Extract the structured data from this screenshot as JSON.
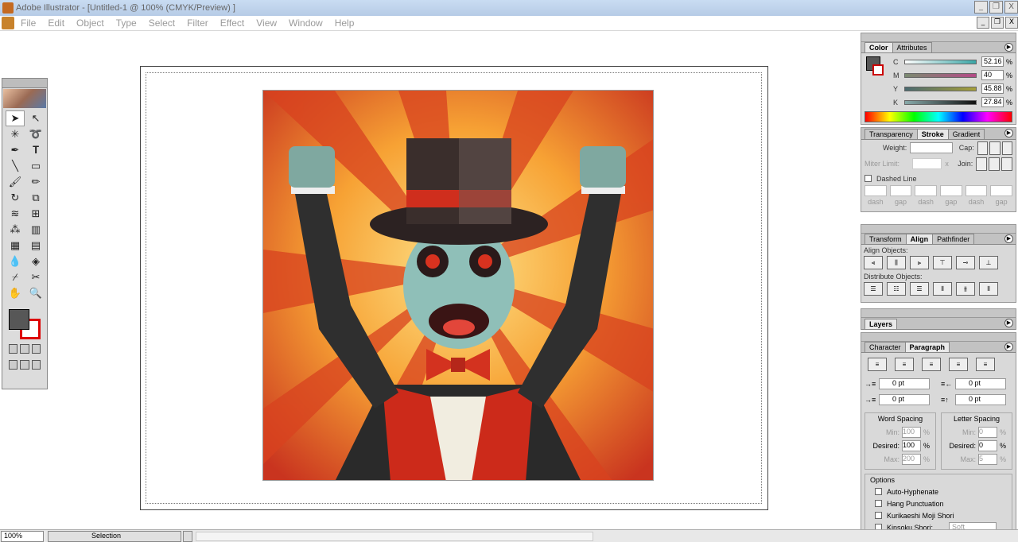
{
  "window": {
    "title": "Adobe Illustrator - [Untitled-1 @ 100% (CMYK/Preview) ]",
    "minimize": "_",
    "restore": "❐",
    "close": "X"
  },
  "menu": [
    "File",
    "Edit",
    "Object",
    "Type",
    "Select",
    "Filter",
    "Effect",
    "View",
    "Window",
    "Help"
  ],
  "color_panel": {
    "tabs": [
      "Color",
      "Attributes"
    ],
    "channels": [
      {
        "label": "C",
        "value": "52.16",
        "unit": "%",
        "color": "#3aa6a6"
      },
      {
        "label": "M",
        "value": "40",
        "unit": "%",
        "color": "#b44a86"
      },
      {
        "label": "Y",
        "value": "45.88",
        "unit": "%",
        "color": "#a7a03a"
      },
      {
        "label": "K",
        "value": "27.84",
        "unit": "%",
        "color": "#222222"
      }
    ]
  },
  "stroke_panel": {
    "tabs": [
      "Transparency",
      "Stroke",
      "Gradient"
    ],
    "weight_label": "Weight:",
    "cap_label": "Cap:",
    "miter_label": "Miter Limit:",
    "miter_unit": "x",
    "join_label": "Join:",
    "dashed_label": "Dashed Line",
    "dash_labels": [
      "dash",
      "gap",
      "dash",
      "gap",
      "dash",
      "gap"
    ]
  },
  "align_panel": {
    "tabs": [
      "Transform",
      "Align",
      "Pathfinder"
    ],
    "align_objects": "Align Objects:",
    "distribute_objects": "Distribute Objects:"
  },
  "layers_panel": {
    "title": "Layers"
  },
  "paragraph_panel": {
    "tabs": [
      "Character",
      "Paragraph"
    ],
    "indent_values": [
      "0 pt",
      "0 pt",
      "0 pt",
      "0 pt"
    ],
    "word_spacing": {
      "title": "Word Spacing",
      "min_label": "Min:",
      "min": "100",
      "desired_label": "Desired:",
      "desired": "100",
      "max_label": "Max:",
      "max": "200",
      "unit": "%"
    },
    "letter_spacing": {
      "title": "Letter Spacing",
      "min_label": "Min:",
      "min": "0",
      "desired_label": "Desired:",
      "desired": "0",
      "max_label": "Max:",
      "max": "5",
      "unit": "%"
    },
    "options_title": "Options",
    "options": [
      "Auto-Hyphenate",
      "Hang Punctuation",
      "Kurikaeshi Moji Shori",
      "Kinsoku Shori:"
    ],
    "kinsoku_value": "Soft"
  },
  "status": {
    "zoom": "100%",
    "mode": "Selection"
  },
  "colors": {
    "fill": "#575757",
    "stroke": "#dd0000"
  }
}
